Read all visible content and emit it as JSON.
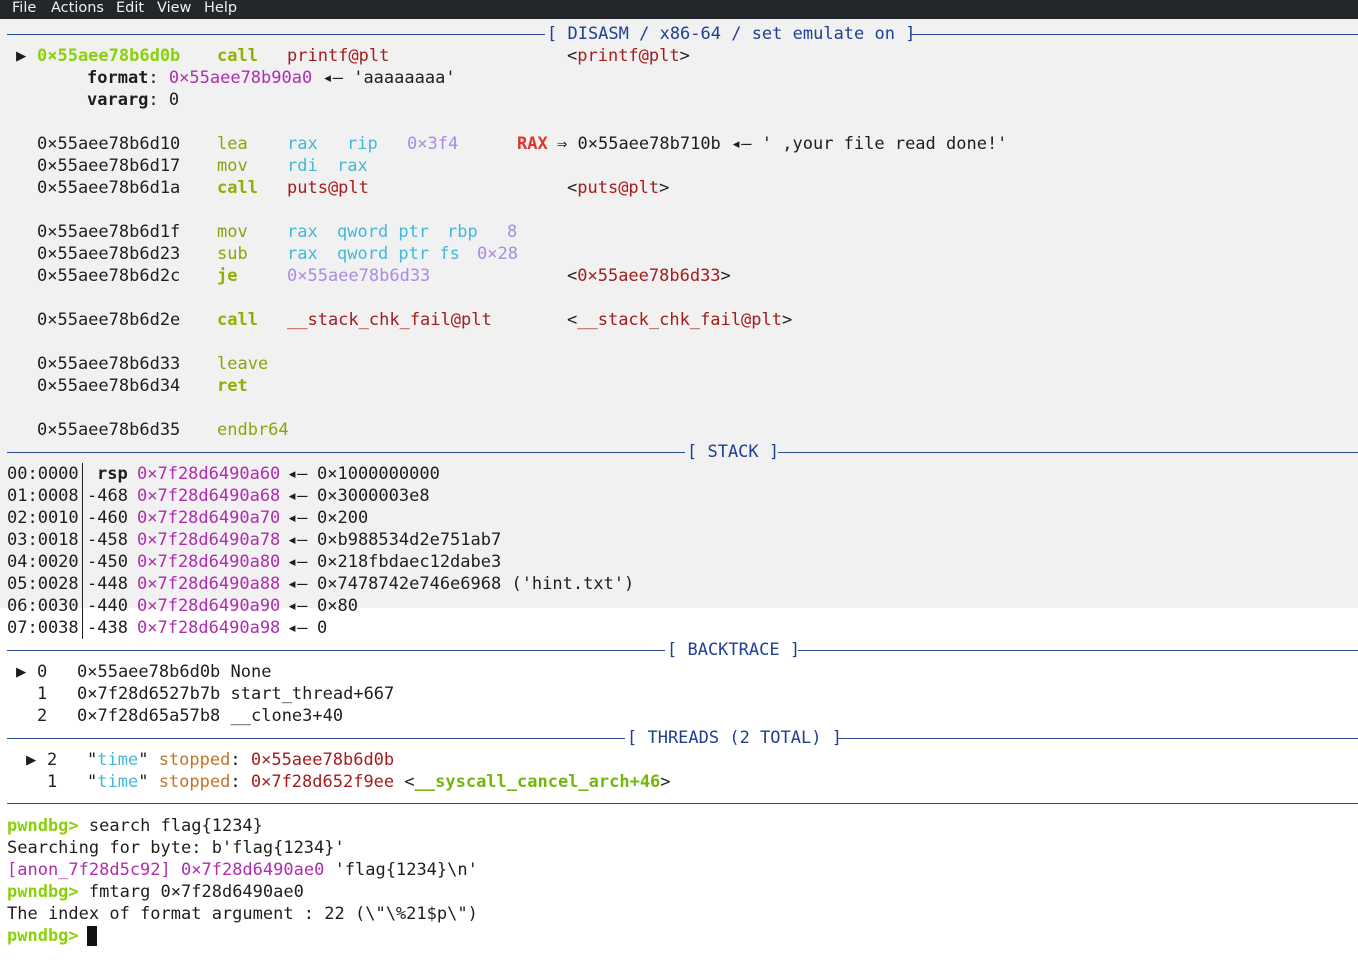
{
  "menu": [
    "File",
    "Actions",
    "Edit",
    "View",
    "Help"
  ],
  "headers": {
    "disasm": "[ DISASM / x86-64 / set emulate on ]",
    "stack": "[ STACK ]",
    "backtrace": "[ BACKTRACE ]",
    "threads": "[ THREADS (2 TOTAL) ]"
  },
  "disasm": {
    "current": {
      "marker": "▶",
      "addr": "0×55aee78b6d0b",
      "mnem": "call",
      "op": "printf@plt",
      "target_open": "<",
      "target": "printf@plt",
      "target_close": ">"
    },
    "args": [
      {
        "name": "format",
        "colon": ":",
        "value": "0×55aee78b90a0",
        "arrow": "◂—",
        "str": "'aaaaaaaa'"
      },
      {
        "name": "vararg",
        "colon": ":",
        "value": "0"
      }
    ],
    "lines": {
      "l1": {
        "addr": "0×55aee78b6d10",
        "mnem": "lea",
        "o1": "rax",
        "o2": "rip",
        "o3": "0×3f4",
        "reg": "RAX",
        "arrow": "⇒",
        "val": "0×55aee78b710b",
        "arr2": "◂—",
        "str": "' ,your file read done!'"
      },
      "l2": {
        "addr": "0×55aee78b6d17",
        "mnem": "mov",
        "o1": "rdi",
        "o2": "rax"
      },
      "l3": {
        "addr": "0×55aee78b6d1a",
        "mnem": "call",
        "o1": "puts@plt",
        "t_open": "<",
        "target": "puts@plt",
        "t_close": ">"
      },
      "l4": {
        "addr": "0×55aee78b6d1f",
        "mnem": "mov",
        "o1": "rax",
        "o2": "qword ptr",
        "o3": "rbp",
        "o4": "8"
      },
      "l5": {
        "addr": "0×55aee78b6d23",
        "mnem": "sub",
        "o1": "rax",
        "o2": "qword ptr fs",
        "o3": "0×28"
      },
      "l6": {
        "addr": "0×55aee78b6d2c",
        "mnem": "je",
        "o1": "0×55aee78b6d33",
        "t_open": "<",
        "target": "0×55aee78b6d33",
        "t_close": ">"
      },
      "l7": {
        "addr": "0×55aee78b6d2e",
        "mnem": "call",
        "o1": "__stack_chk_fail@plt",
        "t_open": "<",
        "target": "__stack_chk_fail@plt",
        "t_close": ">"
      },
      "l8": {
        "addr": "0×55aee78b6d33",
        "mnem": "leave"
      },
      "l9": {
        "addr": "0×55aee78b6d34",
        "mnem": "ret"
      },
      "l10": {
        "addr": "0×55aee78b6d35",
        "mnem": "endbr64"
      }
    }
  },
  "stack": [
    {
      "idx": "00:0000",
      "off": "rsp",
      "addr": "0×7f28d6490a60",
      "arrow": "◂—",
      "val": "0×1000000000"
    },
    {
      "idx": "01:0008",
      "off": "-468",
      "addr": "0×7f28d6490a68",
      "arrow": "◂—",
      "val": "0×3000003e8"
    },
    {
      "idx": "02:0010",
      "off": "-460",
      "addr": "0×7f28d6490a70",
      "arrow": "◂—",
      "val": "0×200"
    },
    {
      "idx": "03:0018",
      "off": "-458",
      "addr": "0×7f28d6490a78",
      "arrow": "◂—",
      "val": "0×b988534d2e751ab7"
    },
    {
      "idx": "04:0020",
      "off": "-450",
      "addr": "0×7f28d6490a80",
      "arrow": "◂—",
      "val": "0×218fbdaec12dabe3"
    },
    {
      "idx": "05:0028",
      "off": "-448",
      "addr": "0×7f28d6490a88",
      "arrow": "◂—",
      "val": "0×7478742e746e6968 ('hint.txt')"
    },
    {
      "idx": "06:0030",
      "off": "-440",
      "addr": "0×7f28d6490a90",
      "arrow": "◂—",
      "val": "0×80"
    },
    {
      "idx": "07:0038",
      "off": "-438",
      "addr": "0×7f28d6490a98",
      "arrow": "◂—",
      "val": "0"
    }
  ],
  "backtrace": [
    {
      "marker": "▶",
      "num": "0",
      "text": "0×55aee78b6d0b None"
    },
    {
      "marker": "",
      "num": "1",
      "text": "0×7f28d6527b7b start_thread+667"
    },
    {
      "marker": "",
      "num": "2",
      "text": "0×7f28d65a57b8 __clone3+40"
    }
  ],
  "threads": [
    {
      "marker": "▶",
      "num": "2",
      "q1": "\"",
      "name": "time",
      "q2": "\"",
      "state": "stopped",
      "colon": ":",
      "addr": "0×55aee78b6d0b",
      "sym_open": "",
      "sym": "",
      "sym_close": ""
    },
    {
      "marker": "",
      "num": "1",
      "q1": "\"",
      "name": "time",
      "q2": "\"",
      "state": "stopped",
      "colon": ":",
      "addr": "0×7f28d652f9ee",
      "sym_open": "<",
      "sym": "__syscall_cancel_arch+46",
      "sym_close": ">"
    }
  ],
  "console": {
    "prompt": "pwndbg>",
    "cmd1": "search flag{1234}",
    "out1": "Searching for byte: b'flag{1234}'",
    "out2_region": "[anon_7f28d5c92]",
    "out2_addr": "0×7f28d6490ae0",
    "out2_str": "'flag{1234}\\n'",
    "cmd2": "fmtarg 0×7f28d6490ae0",
    "out3": "The index of format argument : 22 (\\\"\\%21$p\\\")",
    "cmd3": ""
  },
  "colors": {
    "rule": "#2b4a94",
    "prompt": "#8bd10a",
    "mnemonic": "#8fa20b",
    "register": "#44b8d8",
    "address": "#b02cb0",
    "call_target": "#a51c1c"
  }
}
